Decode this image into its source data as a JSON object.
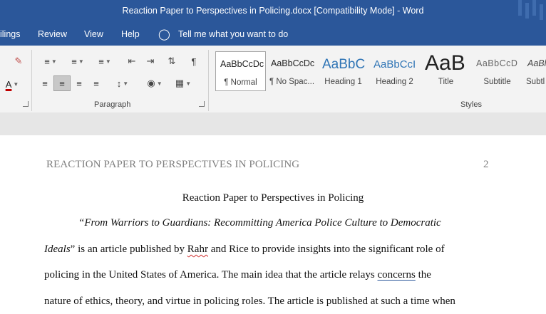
{
  "window": {
    "title": "Reaction Paper to Perspectives in Policing.docx [Compatibility Mode]  -  Word"
  },
  "menu": {
    "mailings": "ilings",
    "review": "Review",
    "view": "View",
    "help": "Help",
    "tell_me": "Tell me what you want to do"
  },
  "ribbon": {
    "paragraph_label": "Paragraph",
    "styles_label": "Styles",
    "styles": [
      {
        "sample": "AaBbCcDc",
        "label": "¶ Normal"
      },
      {
        "sample": "AaBbCcDc",
        "label": "¶ No Spac..."
      },
      {
        "sample": "AaBbC",
        "label": "Heading 1"
      },
      {
        "sample": "AaBbCcI",
        "label": "Heading 2"
      },
      {
        "sample": "AaB",
        "label": "Title"
      },
      {
        "sample": "AaBbCcD",
        "label": "Subtitle"
      },
      {
        "sample": "AaBl",
        "label": "Subtl"
      }
    ],
    "colors": {
      "accent": "#2b579a",
      "font_color_bar": "#c00000",
      "heading_blue": "#2e74b5"
    }
  },
  "document": {
    "header": "REACTION PAPER TO PERSPECTIVES IN POLICING",
    "page_number": "2",
    "title": "Reaction Paper to Perspectives in Policing",
    "line1": "“From Warriors to Guardians: Recommitting America Police Culture to Democratic",
    "line2_italic": "Ideals",
    "line2_a": "” is an article published by ",
    "line2_misspelled": "Rahr",
    "line2_b": " and Rice to provide insights into the significant role of",
    "line3_a": "policing in the United States of America. The main idea that the article relays ",
    "line3_flagged": "concerns",
    "line3_b": " the",
    "line4": "nature of ethics, theory, and virtue in policing roles. The article is published at such a time when"
  }
}
